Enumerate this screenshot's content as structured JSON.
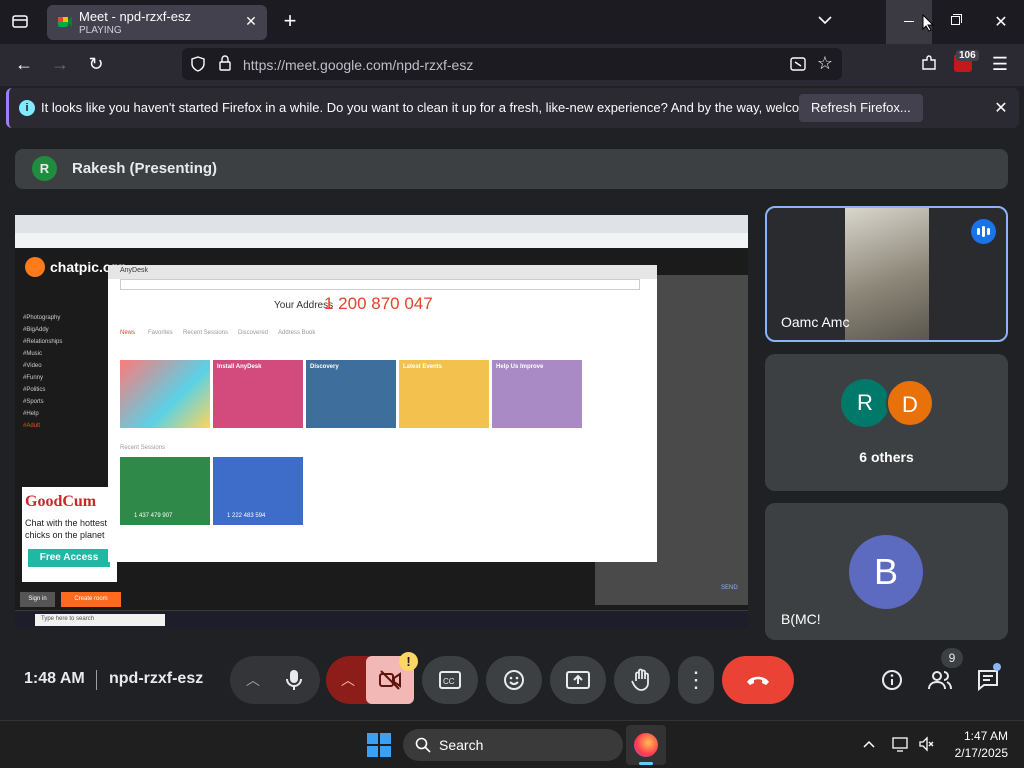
{
  "browser": {
    "tab_title": "Meet - npd-rzxf-esz",
    "tab_status": "PLAYING",
    "url": "https://meet.google.com/npd-rzxf-esz",
    "badge_count": "106",
    "notification": "It looks like you haven't started Firefox in a while. Do you want to clean it up for a fresh, like-new experience? And by the way, welcome back!",
    "notification_button": "Refresh Firefox..."
  },
  "meet": {
    "presenter_initial": "R",
    "presenter_label": "Rakesh (Presenting)",
    "participants": [
      {
        "name": "Oamc Amc"
      },
      {
        "name": "6 others",
        "initials": [
          "R",
          "D"
        ]
      },
      {
        "name": "B(MC!",
        "initial": "B"
      }
    ],
    "time": "1:48 AM",
    "meeting_code": "npd-rzxf-esz",
    "people_count": "9",
    "warning": "!"
  },
  "shared_screen": {
    "brand": "chatpic.org",
    "anydesk_tab": "AnyDesk",
    "your_address_label": "Your Address",
    "your_address": "1 200 870 047",
    "tabs": [
      "News",
      "Favorites",
      "Recent Sessions",
      "Discovered",
      "Address Book"
    ],
    "cards": [
      "Install AnyDesk",
      "Discovery",
      "Latest Events",
      "Help Us Improve"
    ],
    "recent_label": "Recent Sessions",
    "recent": [
      "1 437 479 907",
      "1 222 483 594"
    ],
    "ad_brand": "GoodCum",
    "ad_text": "Chat with the hottest chicks on the planet",
    "ad_button": "Free Access",
    "signin": "Sign in",
    "create_room": "Create room",
    "send": "SEND",
    "search": "Type here to search",
    "sidebar": [
      "#Photography",
      "#BigAddy",
      "#Relationships",
      "#Music",
      "#Video",
      "#Funny",
      "#Politics",
      "#Sports",
      "#Help",
      "#Adult"
    ]
  },
  "taskbar": {
    "search": "Search",
    "time": "1:47 AM",
    "date": "2/17/2025"
  },
  "colors": {
    "accent": "#8ab4f8",
    "red": "#ea4335",
    "purple": "#a07cff"
  }
}
